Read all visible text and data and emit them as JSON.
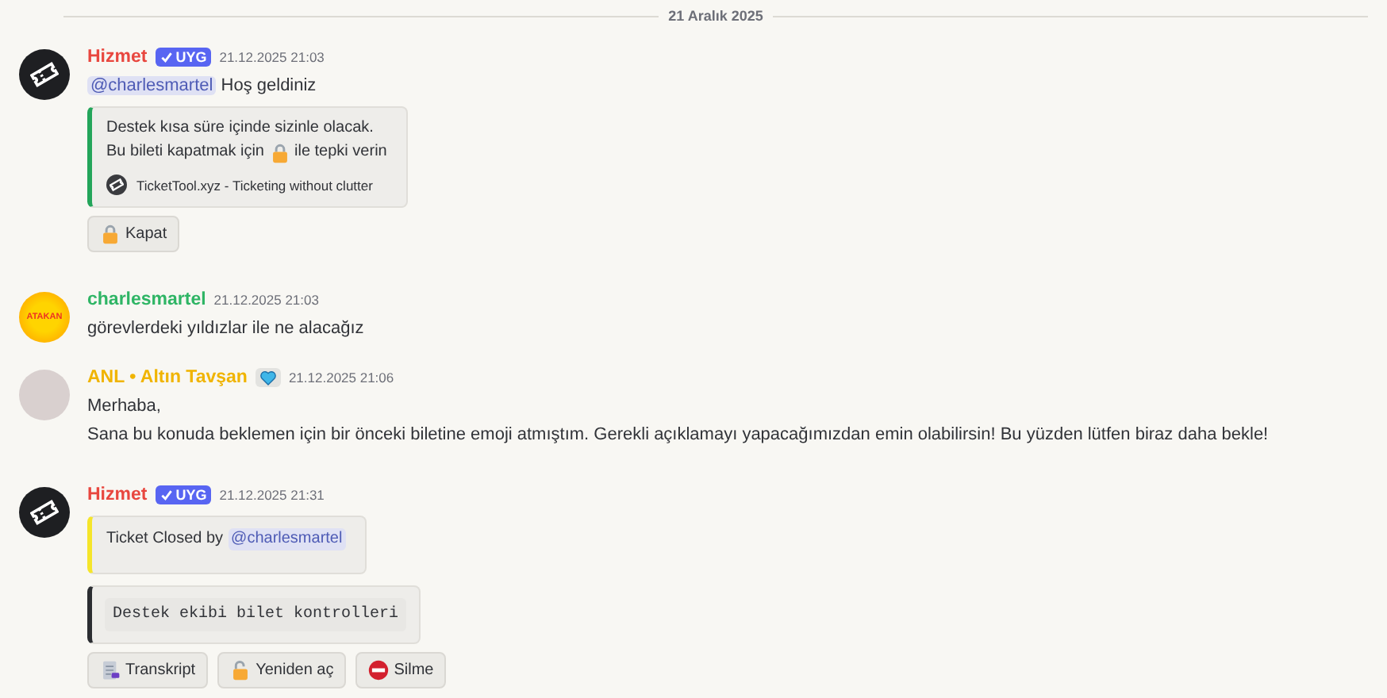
{
  "date_divider": "21 Aralık 2025",
  "messages": [
    {
      "avatar": {
        "kind": "bot"
      },
      "author": "Hizmet",
      "color": "#e8473f",
      "tag": "UYG",
      "role_icon": false,
      "time": "21.12.2025 21:03",
      "blocks": [
        {
          "kind": "text",
          "mention": "@charlesmartel",
          "text": "Hoş geldiniz"
        },
        {
          "kind": "embed",
          "color": "#23a55a",
          "lines": [
            "Destek kısa süre içinde sizinle olacak."
          ],
          "reaction_line": {
            "before": "Bu bileti kapatmak için",
            "after": "ile tepki verin"
          },
          "footer": "TicketTool.xyz - Ticketing without clutter"
        },
        {
          "kind": "buttons",
          "buttons": [
            {
              "kind": "lock",
              "label": "Kapat"
            }
          ]
        }
      ]
    },
    {
      "avatar": {
        "kind": "logo",
        "text": "ATAKAN"
      },
      "author": "charlesmartel",
      "color": "#2fb565",
      "time": "21.12.2025 21:03",
      "role_icon": false,
      "blocks": [
        {
          "kind": "text",
          "text": "görevlerdeki yıldızlar ile ne alacağız"
        }
      ]
    },
    {
      "avatar": {
        "kind": "photo"
      },
      "author": "ANL • Altın Tavşan",
      "color": "#f0b400",
      "role_icon": true,
      "time": "21.12.2025 21:06",
      "blocks": [
        {
          "kind": "text",
          "text": "Merhaba,"
        },
        {
          "kind": "text",
          "text": "Sana bu konuda beklemen için bir önceki biletine emoji atmıştım. Gerekli açıklamayı yapacağımızdan emin olabilirsin! Bu yüzden lütfen biraz daha bekle!"
        }
      ]
    },
    {
      "avatar": {
        "kind": "bot"
      },
      "author": "Hizmet",
      "color": "#e8473f",
      "tag": "UYG",
      "role_icon": false,
      "time": "21.12.2025 21:31",
      "blocks": [
        {
          "kind": "embed",
          "color": "#f5e52a",
          "prefix": "Ticket Closed by",
          "mention": "@charlesmartel"
        },
        {
          "kind": "code_embed",
          "color": "#2b2d31",
          "code": "Destek ekibi bilet kontrolleri"
        },
        {
          "kind": "buttons",
          "buttons": [
            {
              "kind": "document",
              "label": "Transkript"
            },
            {
              "kind": "unlock",
              "label": "Yeniden aç"
            },
            {
              "kind": "no-entry",
              "label": "Silme"
            }
          ]
        }
      ]
    }
  ]
}
